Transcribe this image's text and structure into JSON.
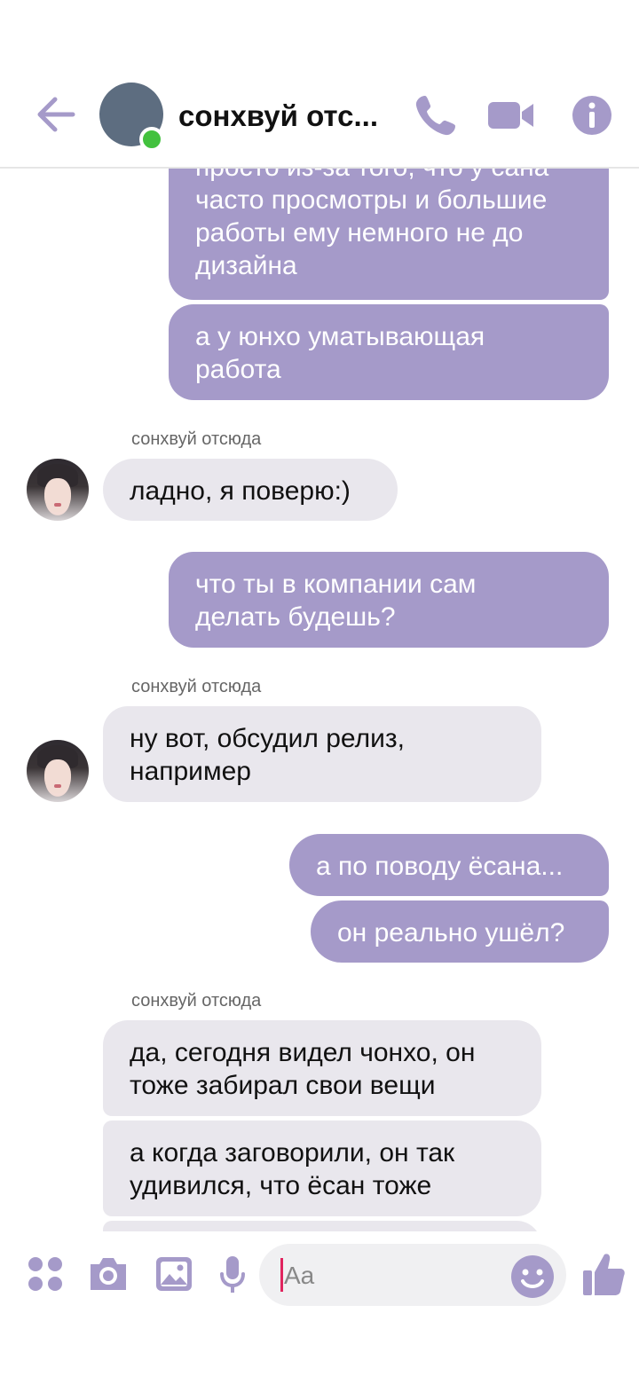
{
  "header": {
    "title": "сонхвуй отс...",
    "online": true,
    "icons": {
      "back": "back-arrow-icon",
      "phone": "phone-icon",
      "video": "video-camera-icon",
      "info": "info-icon"
    }
  },
  "colors": {
    "accent": "#a59ac9",
    "incoming_bubble": "#e9e7ed",
    "online": "#42c13e",
    "caret": "#e0245e"
  },
  "messages": [
    {
      "dir": "out",
      "lines": [
        "просто из-за того, что у сана",
        "часто просмотры и большие",
        "работы ему немного не до",
        "дизайна"
      ]
    },
    {
      "dir": "out",
      "lines": [
        "а у юнхо уматывающая",
        "работа"
      ]
    },
    {
      "dir": "in",
      "sender": "сонхвуй отсюда",
      "lines": [
        "ладно, я поверю:)"
      ]
    },
    {
      "dir": "out",
      "lines": [
        "что ты в компании сам",
        "делать будешь?"
      ]
    },
    {
      "dir": "in",
      "sender": "сонхвуй отсюда",
      "lines": [
        "ну вот, обсудил релиз,",
        "например"
      ]
    },
    {
      "dir": "out",
      "lines": [
        "а по поводу ёсана..."
      ]
    },
    {
      "dir": "out",
      "lines": [
        "он реально ушёл?"
      ]
    },
    {
      "dir": "in",
      "sender": "сонхвуй отсюда",
      "lines": [
        "да, сегодня видел чонхо, он",
        "тоже забирал свои вещи"
      ]
    },
    {
      "dir": "in",
      "lines": [
        "а когда заговорили, он так",
        "удивился, что ёсан тоже"
      ]
    }
  ],
  "composer": {
    "placeholder": "Aa",
    "icons": [
      "apps-icon",
      "camera-icon",
      "gallery-icon",
      "microphone-icon",
      "emoji-icon",
      "thumbs-up-icon"
    ]
  }
}
